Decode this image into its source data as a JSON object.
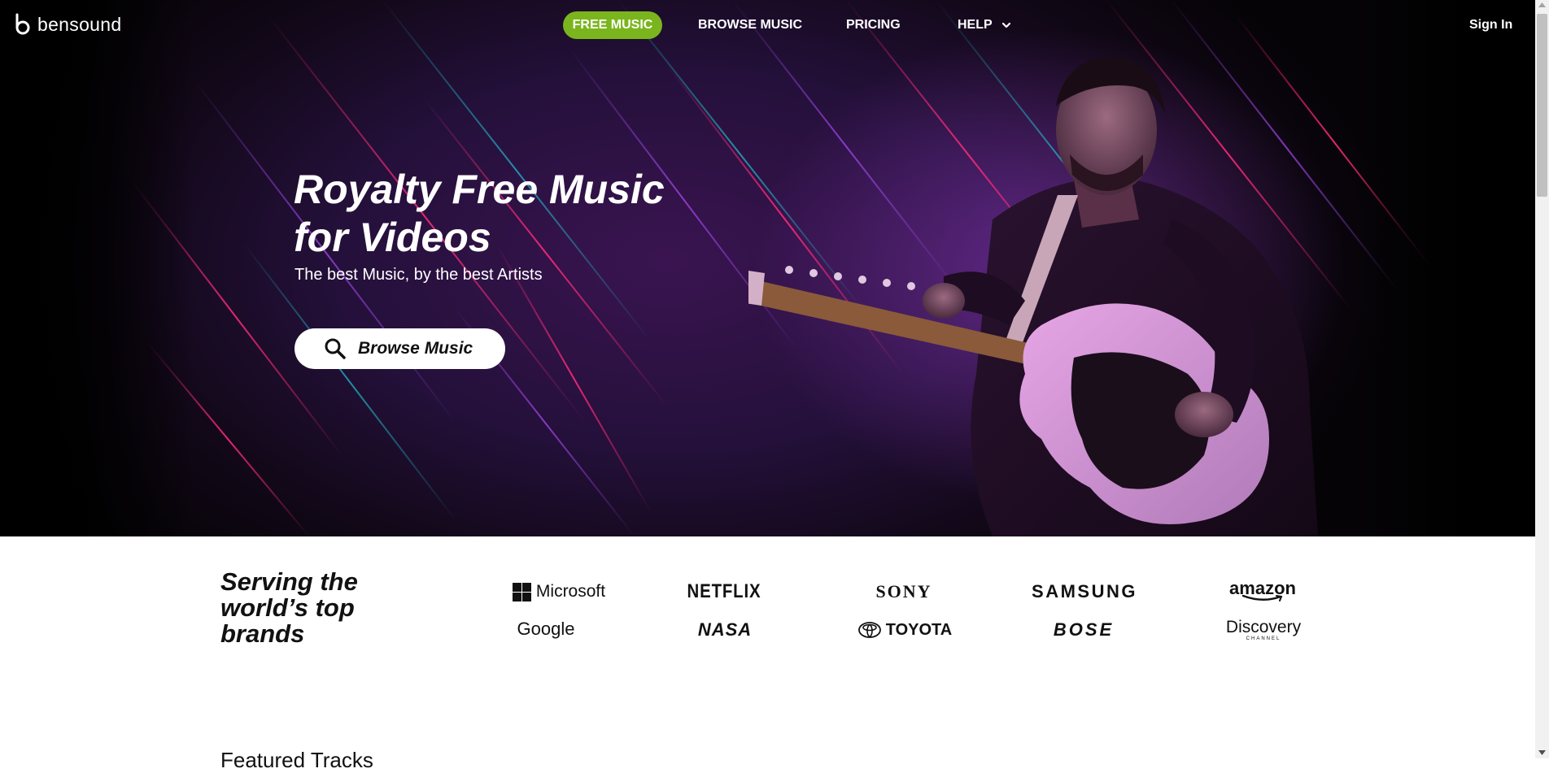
{
  "nav": {
    "logo_text": "bensound",
    "free_music": "FREE MUSIC",
    "browse_music": "BROWSE MUSIC",
    "pricing": "PRICING",
    "help": "HELP",
    "sign_in": "Sign In"
  },
  "hero": {
    "title_line1": "Royalty Free Music",
    "title_line2": "for Videos",
    "subtitle": "The best Music, by the best Artists",
    "browse_button": "Browse Music"
  },
  "brands": {
    "title_line1": "Serving the",
    "title_line2": "world’s top",
    "title_line3": "brands",
    "logos": [
      "Microsoft",
      "NETFLIX",
      "SONY",
      "SAMSUNG",
      "amazon",
      "Google",
      "NASA",
      "TOYOTA",
      "BOSE",
      "Discovery"
    ],
    "discovery_sub": "CHANNEL"
  },
  "featured": {
    "title": "Featured Tracks"
  },
  "colors": {
    "accent_green": "#7ab51d",
    "hero_purple": "#3a1450",
    "streak_pink": "#ff2a7a",
    "streak_teal": "#22c6d6"
  },
  "icons": {
    "logo": "bensound-b-icon",
    "help_dropdown": "chevron-down-icon",
    "browse": "search-icon"
  }
}
